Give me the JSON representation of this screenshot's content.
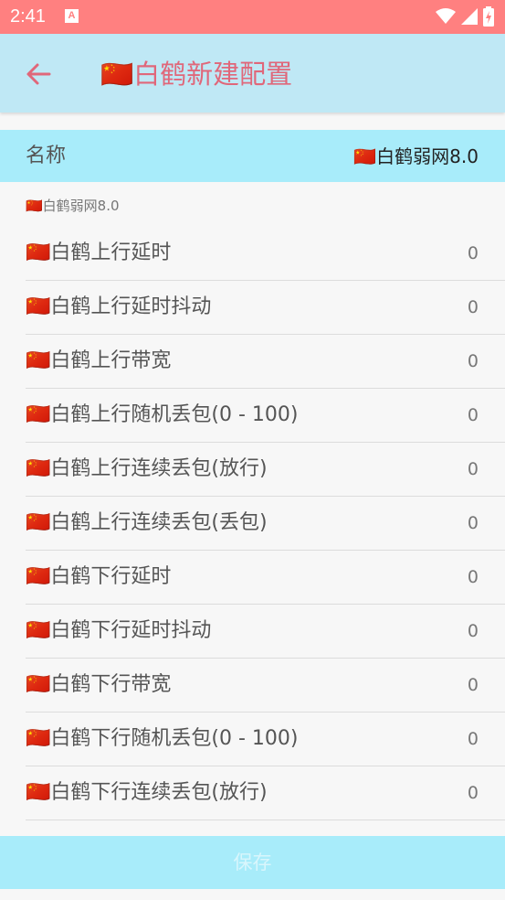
{
  "status_bar": {
    "time": "2:41",
    "notification_icon": "android-a-icon",
    "icons": [
      "wifi-icon",
      "signal-icon",
      "battery-icon"
    ]
  },
  "app_bar": {
    "back_icon": "arrow-left-icon",
    "title": "🇨🇳白鹤新建配置"
  },
  "name_field": {
    "label": "名称",
    "value": "🇨🇳白鹤弱网8.0"
  },
  "section": {
    "caption": "🇨🇳白鹤弱网8.0"
  },
  "settings": [
    {
      "label": "🇨🇳白鹤上行延时",
      "value": "0"
    },
    {
      "label": "🇨🇳白鹤上行延时抖动",
      "value": "0"
    },
    {
      "label": "🇨🇳白鹤上行带宽",
      "value": "0"
    },
    {
      "label": "🇨🇳白鹤上行随机丢包(0 - 100)",
      "value": "0"
    },
    {
      "label": "🇨🇳白鹤上行连续丢包(放行)",
      "value": "0"
    },
    {
      "label": "🇨🇳白鹤上行连续丢包(丢包)",
      "value": "0"
    },
    {
      "label": "🇨🇳白鹤下行延时",
      "value": "0"
    },
    {
      "label": "🇨🇳白鹤下行延时抖动",
      "value": "0"
    },
    {
      "label": "🇨🇳白鹤下行带宽",
      "value": "0"
    },
    {
      "label": "🇨🇳白鹤下行随机丢包(0 - 100)",
      "value": "0"
    },
    {
      "label": "🇨🇳白鹤下行连续丢包(放行)",
      "value": "0"
    }
  ],
  "save": {
    "label": "保存"
  },
  "colors": {
    "status_bar": "#ff8080",
    "app_bar": "#bfe8f5",
    "accent_bar": "#a8ecfa",
    "title_text": "#e0677a"
  }
}
